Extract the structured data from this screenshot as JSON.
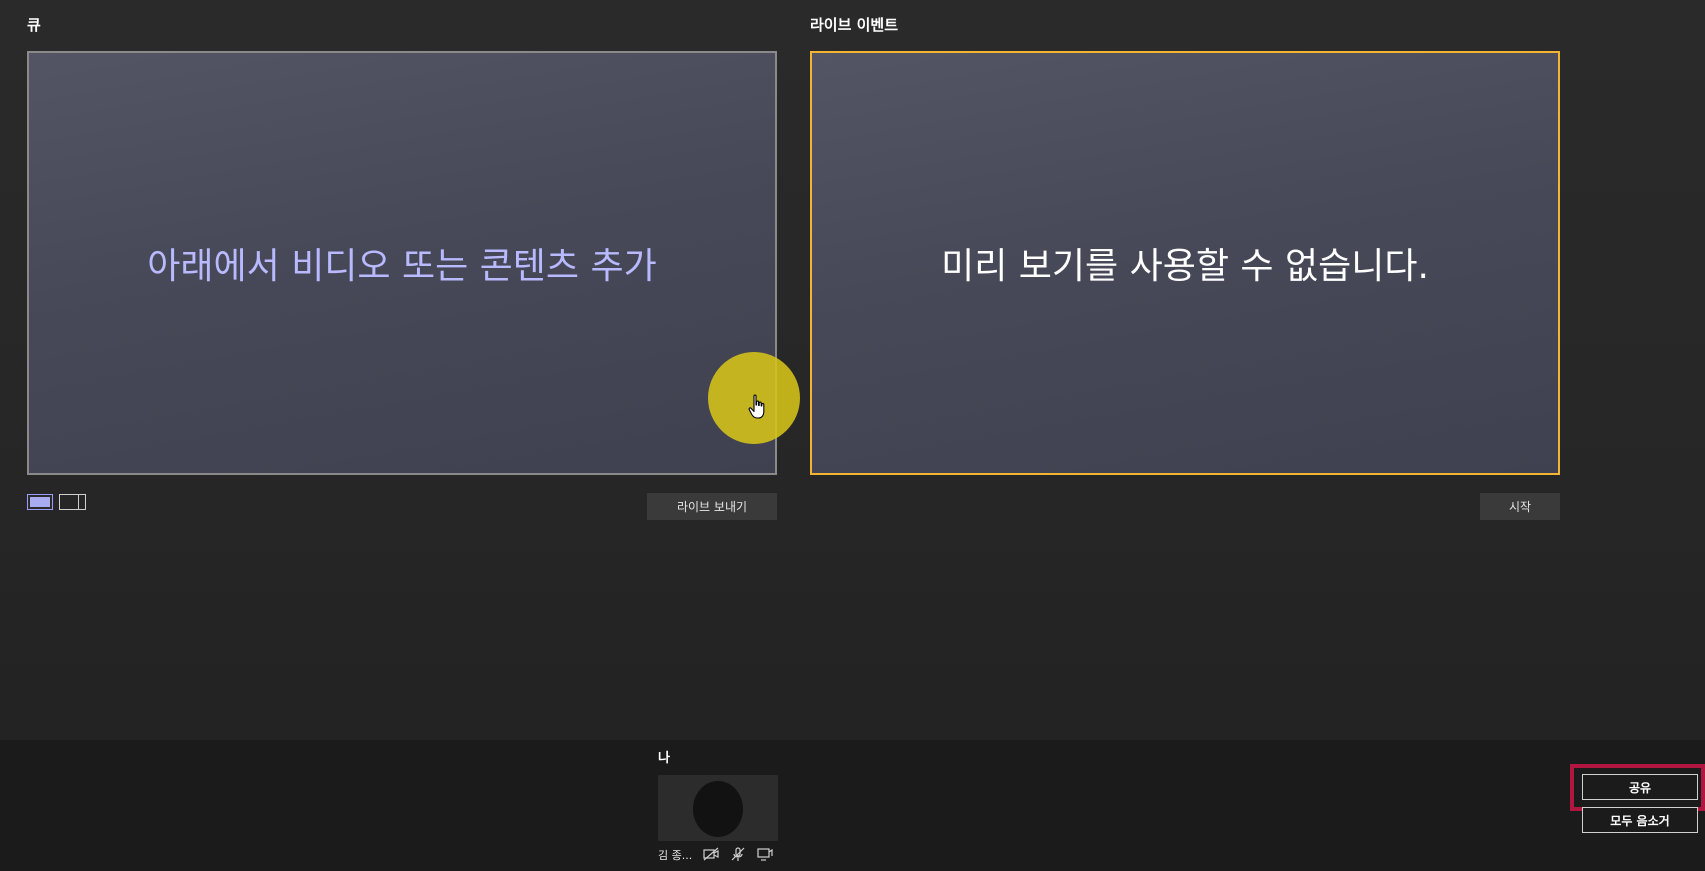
{
  "queue": {
    "title": "큐",
    "placeholder": "아래에서 비디오 또는 콘텐츠 추가",
    "send_live_label": "라이브 보내기",
    "layout_icons": [
      "single-layout-icon",
      "split-layout-icon"
    ]
  },
  "live": {
    "title": "라이브 이벤트",
    "preview_text": "미리 보기를 사용할 수 없습니다.",
    "start_label": "시작"
  },
  "participants": {
    "section_label": "나",
    "me": {
      "name": "김 종...",
      "icons": [
        "camera-off-icon",
        "mic-off-icon",
        "screen-share-icon"
      ]
    }
  },
  "actions": {
    "share_label": "공유",
    "mute_all_label": "모두 음소거"
  },
  "colors": {
    "live_border": "#f3b431",
    "queue_text": "#b8b9ff",
    "click_highlight": "#d6c418",
    "annotation_box": "#b0163f"
  }
}
